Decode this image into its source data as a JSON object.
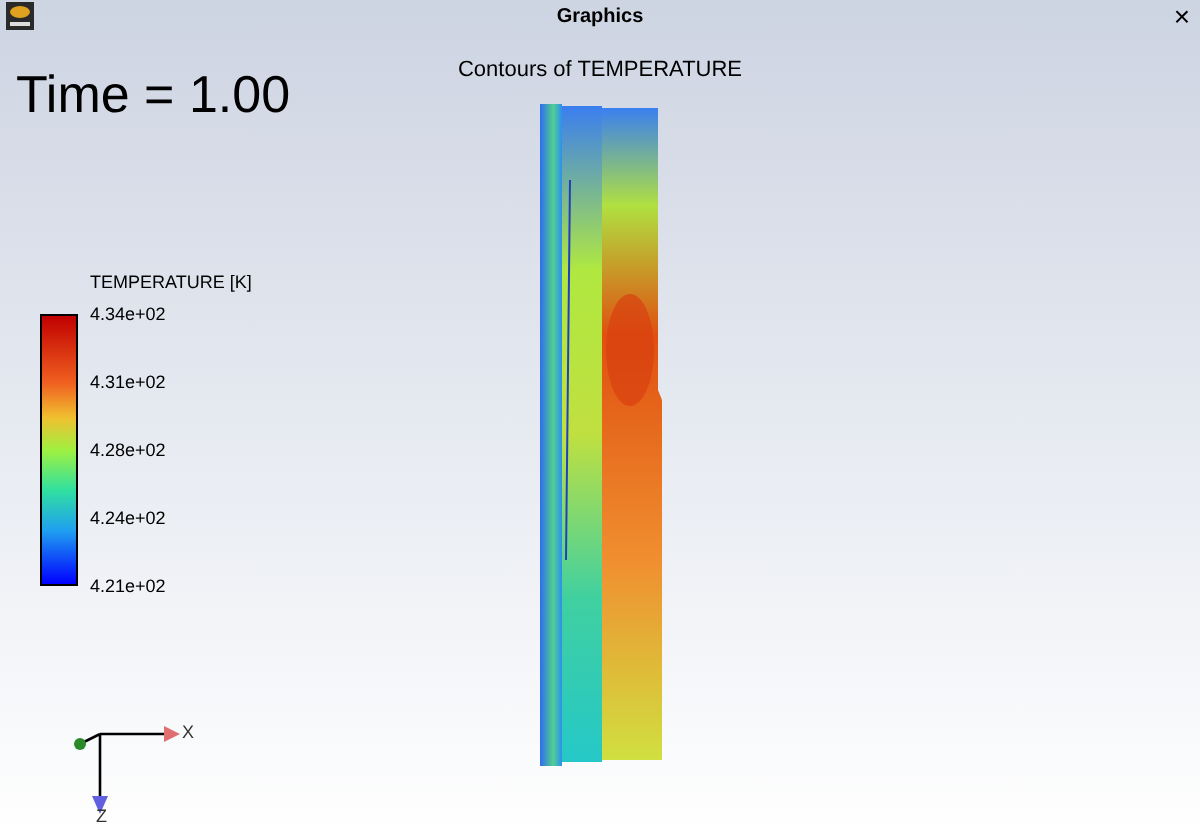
{
  "window": {
    "title": "Graphics",
    "close": "×"
  },
  "time_label": "Time = 1.00",
  "plot_title": "Contours of TEMPERATURE",
  "legend": {
    "title": "TEMPERATURE [K]",
    "labels": [
      "4.34e+02",
      "4.31e+02",
      "4.28e+02",
      "4.24e+02",
      "4.21e+02"
    ]
  },
  "axes": {
    "x_label": "X",
    "z_label": "Z"
  }
}
